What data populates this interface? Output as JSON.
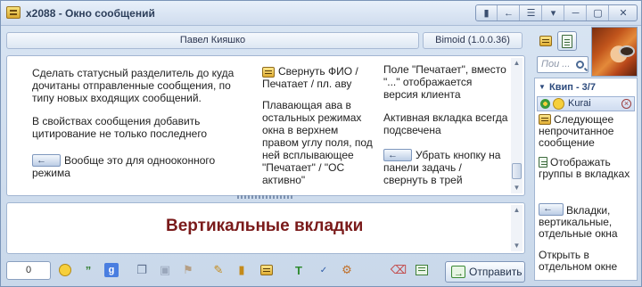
{
  "window": {
    "title": "x2088 - Окно сообщений",
    "controls": [
      "pin-icon",
      "back-icon",
      "menu-icon",
      "dropdown-icon",
      "minimize-icon",
      "maximize-icon",
      "close-icon"
    ]
  },
  "header": {
    "contact_name": "Павел Кияшко",
    "client_version": "Bimoid (1.0.0.36)"
  },
  "search": {
    "placeholder": "Пои ..."
  },
  "history": {
    "col1": [
      {
        "text": "Сделать статусный разделитель до куда дочитаны отправленные сообщения, по типу новых входящих сообщений."
      },
      {
        "text": "В свойствах сообщения добавить цитирование не только последнего"
      },
      {
        "text": "Вообще это для однооконного режима",
        "icon": "command-icon"
      }
    ],
    "col2": [
      {
        "text": "Свернуть ФИО / Печатает / пл. аву",
        "icon": "note-icon"
      },
      {
        "text": "Плавающая ава в остальных режимах окна в верхнем правом углу поля, под ней всплывающее \"Печатает\" / \"ОС активно\""
      }
    ],
    "col3": [
      {
        "text": "Поле \"Печатает\", вместо \"...\" отображается версия клиента"
      },
      {
        "text": "Активная вкладка всегда подсвечена"
      },
      {
        "text": "Убрать кнопку на панели задачь / свернуть в трей",
        "icon": "command-icon"
      }
    ]
  },
  "input": {
    "text": "Вертикальные вкладки"
  },
  "toolbar": {
    "counter": "0",
    "send_label": "Отправить"
  },
  "sidebar": {
    "group": "Квип - 3/7",
    "contact": "Kurai",
    "items": [
      {
        "text": "Следующее непрочитанное сообщение",
        "icon": "note-icon"
      },
      {
        "text": "Отображать группы в вкладках",
        "icon": "clipboard-icon"
      },
      {
        "text": "Вкладки, вертикальные, отдельные окна",
        "icon": "command-icon"
      },
      {
        "text": "Открыть в отдельном окне"
      }
    ]
  }
}
